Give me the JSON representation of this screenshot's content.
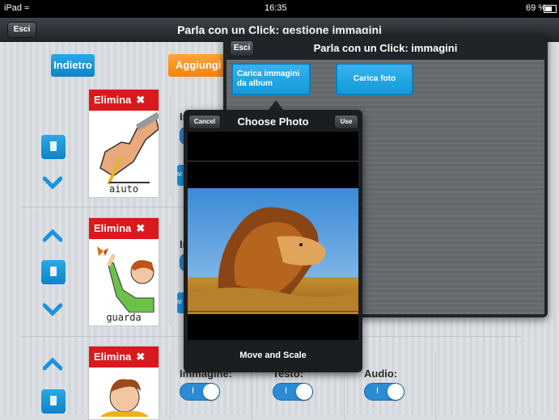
{
  "status": {
    "device": "iPad",
    "time": "16:35",
    "battery": "69 %"
  },
  "nav": {
    "esci": "Esci",
    "title": "Parla con un Click: gestione immagini"
  },
  "main": {
    "back": "Indietro",
    "add": "Aggiungi",
    "rows": [
      {
        "delete": "Elimina",
        "word": "aiuto"
      },
      {
        "delete": "Elimina",
        "word": "guarda"
      },
      {
        "delete": "Elimina",
        "word": ""
      }
    ],
    "labels": {
      "image": "Immagine:",
      "text": "Testo:",
      "audio": "Audio:"
    },
    "toggle_on": "I"
  },
  "gallery": {
    "esci": "Esci",
    "title": "Parla con un Click: immagini",
    "album_btn": "Carica immagini da album",
    "photo_btn": "Carica foto"
  },
  "picker": {
    "cancel": "Cancel",
    "title": "Choose Photo",
    "use": "Use",
    "move": "Move and Scale"
  },
  "colors": {
    "accent": "#1a93d8",
    "delete": "#d8191d",
    "orange": "#f5820f"
  }
}
